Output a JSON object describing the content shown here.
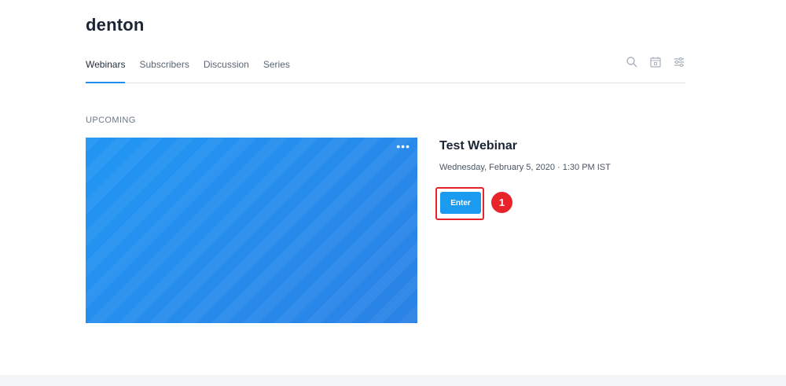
{
  "brand": "denton",
  "nav": {
    "tabs": [
      {
        "label": "Webinars",
        "active": true
      },
      {
        "label": "Subscribers"
      },
      {
        "label": "Discussion"
      },
      {
        "label": "Series"
      }
    ],
    "icons": [
      "search-icon",
      "calendar-icon",
      "settings-sliders-icon"
    ]
  },
  "section": {
    "label": "UPCOMING"
  },
  "webinar": {
    "title": "Test Webinar",
    "datetime": "Wednesday, February 5, 2020 · 1:30 PM IST",
    "enter_label": "Enter",
    "more_label": "•••",
    "thumbnail_color": "#2196f3"
  },
  "annotation": {
    "badge": "1",
    "color": "#e8242b"
  },
  "colors": {
    "accent": "#1f8dea",
    "button": "#1a9bef"
  }
}
